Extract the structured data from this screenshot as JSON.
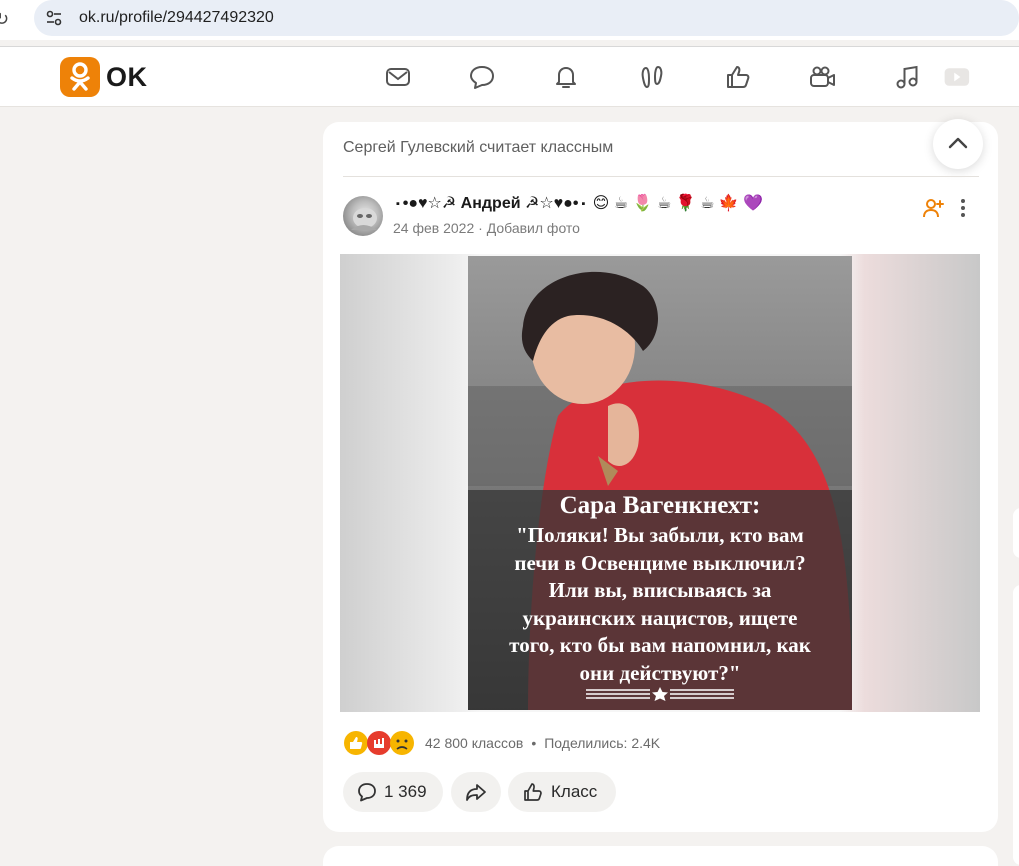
{
  "browser": {
    "url": "ok.ru/profile/294427492320"
  },
  "header": {
    "logo_text": "OK",
    "brand_color": "#ee8208",
    "nav_icons": [
      "mail-icon",
      "chat-icon",
      "bell-icon",
      "guests-icon",
      "likes-icon",
      "video-icon",
      "music-icon",
      "play-icon"
    ]
  },
  "post": {
    "liked_by": "Сергей Гулевский считает классным",
    "author_name": "٠•●♥☆☭ Андрей ☭☆♥●•٠ 😊 ☕ 🌷 ☕ 🌹 ☕ 🍁 💜",
    "date": "24 фев 2022",
    "action": "Добавил фото",
    "photo": {
      "caption_title": "Сара Вагенкнехт:",
      "caption_text": "\"Поляки! Вы забыли, кто вам\nпечи в Освенциме выключил?\nИли вы, вписываясь за\nукраинских нацистов, ищете\nтого, кто бы вам напомнил, как\nони действуют?\""
    },
    "stats": {
      "classes": "42 800 классов",
      "shared": "Поделились: 2.4K"
    },
    "actions": {
      "comments": "1 369",
      "klass_label": "Класс"
    }
  }
}
